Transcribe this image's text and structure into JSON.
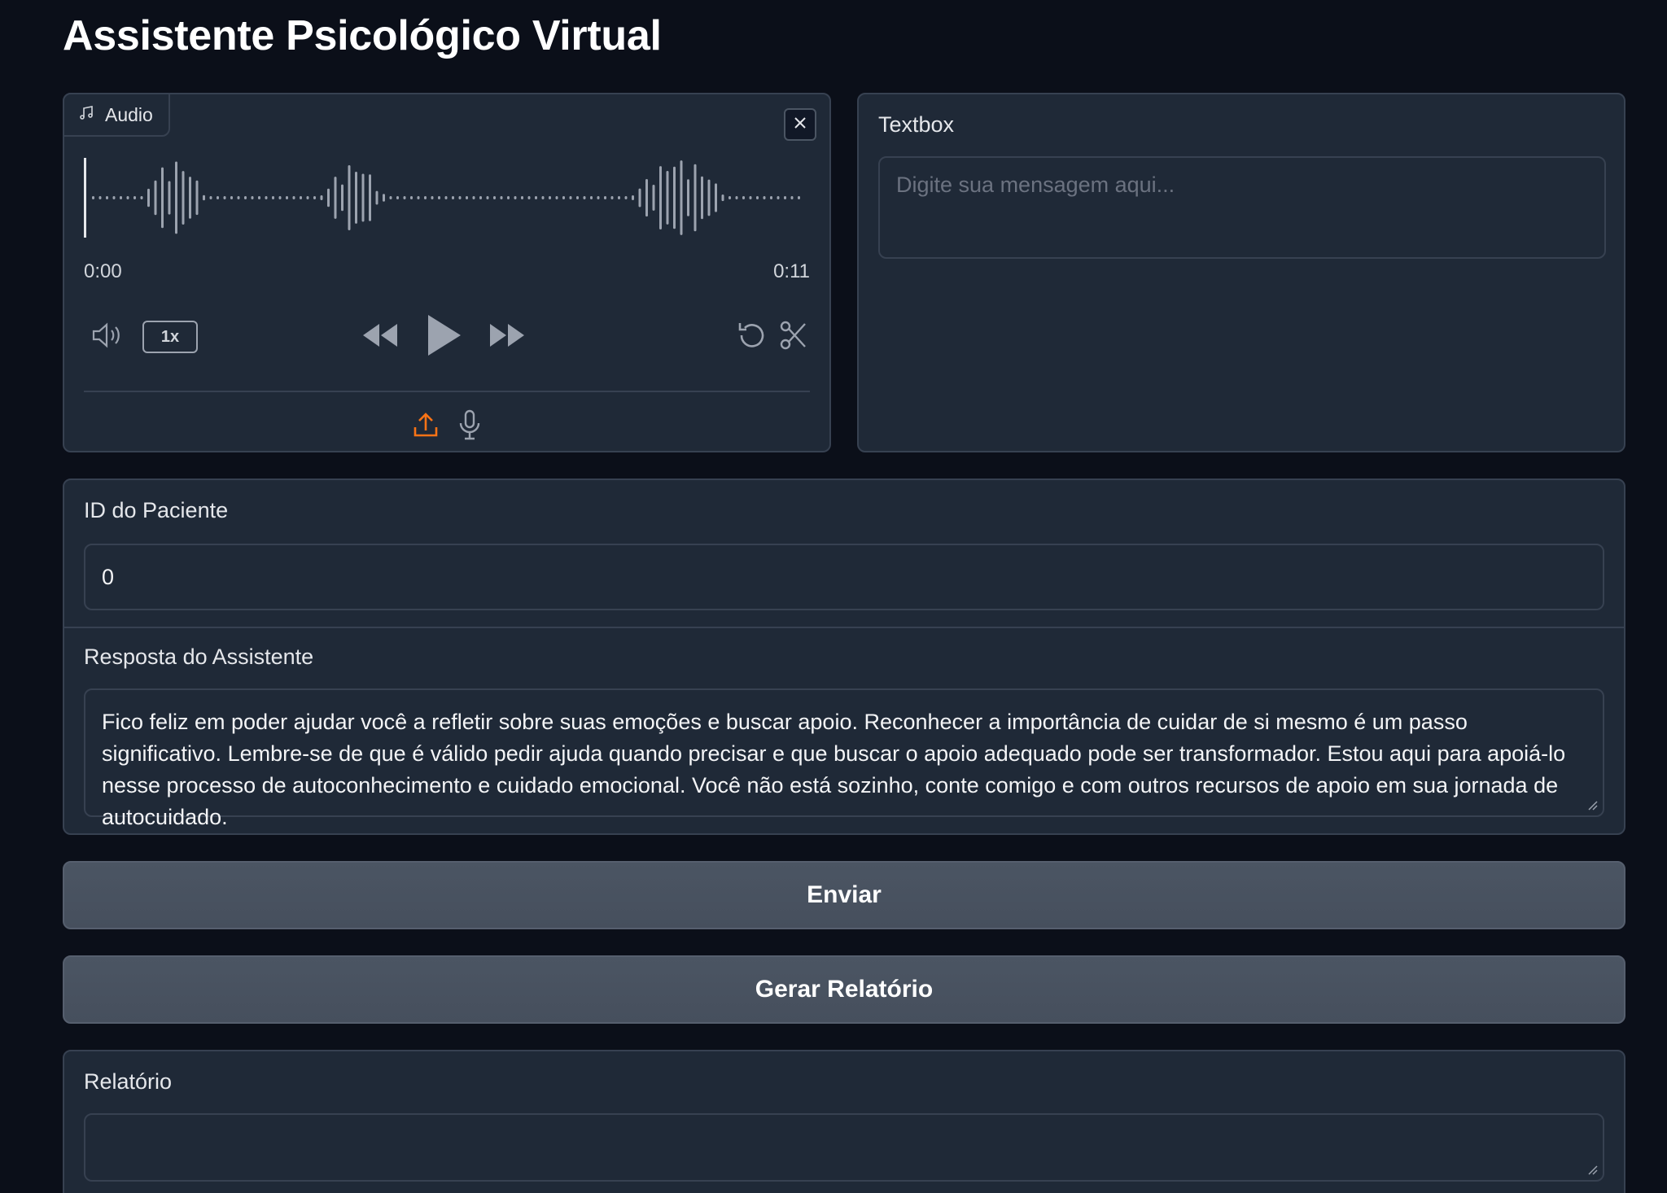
{
  "page": {
    "title": "Assistente Psicológico Virtual"
  },
  "audio": {
    "label": "Audio",
    "time_current": "0:00",
    "time_total": "0:11",
    "playback_rate": "1x",
    "progress": 0.0,
    "icons": [
      "music-note-icon",
      "close-icon",
      "volume-icon",
      "rewind-icon",
      "play-icon",
      "fast-forward-icon",
      "undo-icon",
      "scissors-icon",
      "upload-icon",
      "microphone-icon"
    ],
    "accent_color": "#f97316"
  },
  "textbox": {
    "label": "Textbox",
    "value": "",
    "placeholder": "Digite sua mensagem aqui..."
  },
  "patient": {
    "label": "ID do Paciente",
    "value": "0"
  },
  "response": {
    "label": "Resposta do Assistente",
    "value": "Fico feliz em poder ajudar você a refletir sobre suas emoções e buscar apoio. Reconhecer a importância de cuidar de si mesmo é um passo significativo. Lembre-se de que é válido pedir ajuda quando precisar e que buscar o apoio adequado pode ser transformador. Estou aqui para apoiá-lo nesse processo de autoconhecimento e cuidado emocional. Você não está sozinho, conte comigo e com outros recursos de apoio em sua jornada de autocuidado."
  },
  "buttons": {
    "send_label": "Enviar",
    "report_label": "Gerar Relatório"
  },
  "report": {
    "label": "Relatório",
    "value": ""
  },
  "colors": {
    "background": "#0b0f19",
    "panel": "#1f2937",
    "border": "#374151",
    "button": "#4b5563"
  }
}
